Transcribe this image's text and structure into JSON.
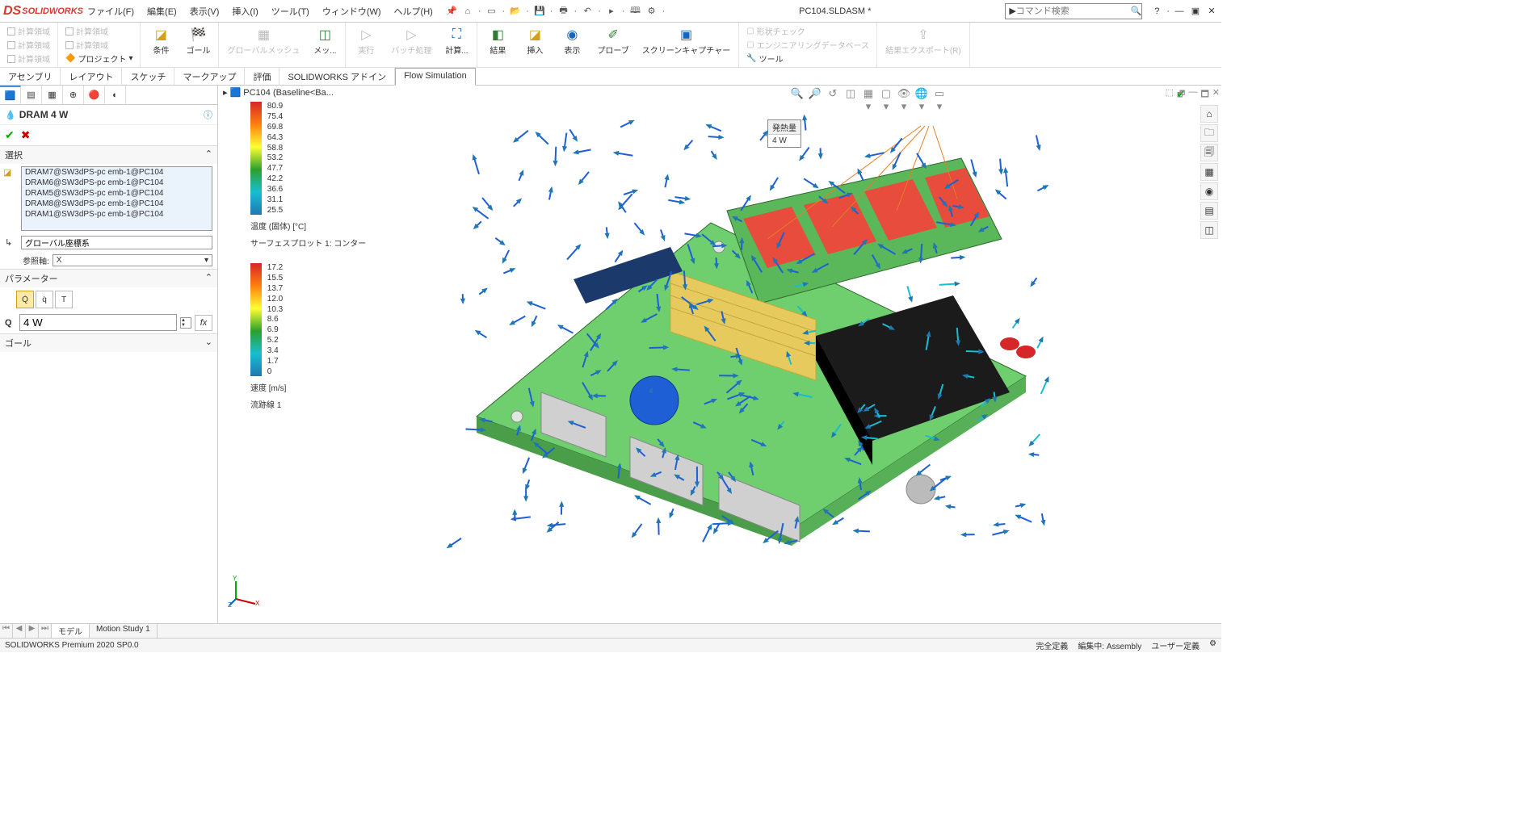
{
  "app": {
    "brand": "SOLIDWORKS"
  },
  "menu": {
    "file": "ファイル(F)",
    "edit": "編集(E)",
    "view": "表示(V)",
    "insert": "挿入(I)",
    "tools": "ツール(T)",
    "window": "ウィンドウ(W)",
    "help": "ヘルプ(H)"
  },
  "doc_title": "PC104.SLDASM *",
  "search": {
    "placeholder": "コマンド検索"
  },
  "ribbon": {
    "grp1": {
      "a": "計算領域",
      "b": "計算領域",
      "c": "計算領域",
      "d": "計算領域",
      "e": "計算領域",
      "f": "計算領域",
      "project": "プロジェクト"
    },
    "cond": "条件",
    "goal": "ゴール",
    "mesh": "グローバルメッシュ",
    "mesh2": "メッ...",
    "run": "実行",
    "batch": "バッチ処理",
    "calc": "計算...",
    "result": "結果",
    "insert": "挿入",
    "display": "表示",
    "probe": "プローブ",
    "capture": "スクリーンキャプチャー",
    "shape": "形状チェック",
    "engdb": "エンジニアリングデータベース",
    "tools": "ツール",
    "export": "結果エクスポート(R)"
  },
  "tabs": {
    "assembly": "アセンブリ",
    "layout": "レイアウト",
    "sketch": "スケッチ",
    "markup": "マークアップ",
    "evaluate": "評価",
    "addins": "SOLIDWORKS アドイン",
    "flow": "Flow Simulation"
  },
  "breadcrumb": "PC104  (Baseline<Ba...",
  "prop": {
    "title": "DRAM 4 W",
    "selection_head": "選択",
    "items": [
      "DRAM7@SW3dPS-pc emb-1@PC104",
      "DRAM6@SW3dPS-pc emb-1@PC104",
      "DRAM5@SW3dPS-pc emb-1@PC104",
      "DRAM8@SW3dPS-pc emb-1@PC104",
      "DRAM1@SW3dPS-pc emb-1@PC104"
    ],
    "coord": "グローバル座標系",
    "axis_label": "参照軸:",
    "axis_value": "X",
    "param_head": "パラメーター",
    "q_label": "Q",
    "q_value": "4 W",
    "goal_head": "ゴール"
  },
  "legend1": {
    "labels": [
      "80.9",
      "75.4",
      "69.8",
      "64.3",
      "58.8",
      "53.2",
      "47.7",
      "42.2",
      "36.6",
      "31.1",
      "25.5"
    ],
    "title1": "温度 (固体) [°C]",
    "title2": "サーフェスプロット 1: コンター"
  },
  "legend2": {
    "labels": [
      "17.2",
      "15.5",
      "13.7",
      "12.0",
      "10.3",
      "8.6",
      "6.9",
      "5.2",
      "3.4",
      "1.7",
      "0"
    ],
    "title1": "速度 [m/s]",
    "title2": "流跡線 1"
  },
  "callout": {
    "header": "発熱量",
    "value": "4 W"
  },
  "bottom_tabs": {
    "model": "モデル",
    "motion": "Motion Study 1"
  },
  "status": {
    "left": "SOLIDWORKS Premium 2020 SP0.0",
    "def": "完全定義",
    "edit": "編集中: Assembly",
    "user": "ユーザー定義"
  }
}
